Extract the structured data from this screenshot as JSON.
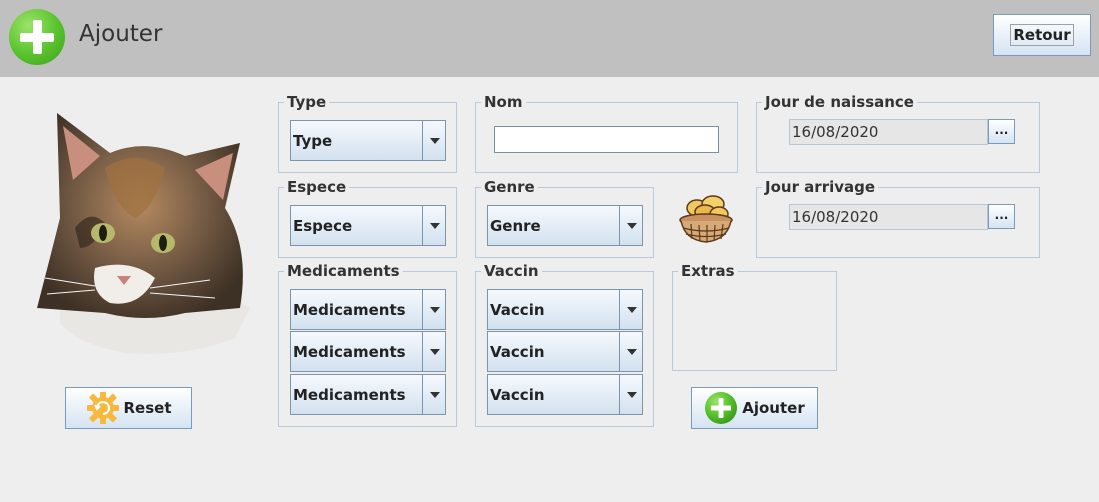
{
  "header": {
    "title": "Ajouter",
    "retour_label": "Retour"
  },
  "form": {
    "type": {
      "legend": "Type",
      "selected": "Type"
    },
    "nom": {
      "legend": "Nom",
      "value": ""
    },
    "jour_naissance": {
      "legend": "Jour de naissance",
      "value": "16/08/2020",
      "button_label": "..."
    },
    "espece": {
      "legend": "Espece",
      "selected": "Espece"
    },
    "genre": {
      "legend": "Genre",
      "selected": "Genre"
    },
    "jour_arrivage": {
      "legend": "Jour arrivage",
      "value": "16/08/2020",
      "button_label": "..."
    },
    "medicaments": {
      "legend": "Medicaments",
      "items": [
        "Medicaments",
        "Medicaments",
        "Medicaments"
      ]
    },
    "vaccin": {
      "legend": "Vaccin",
      "items": [
        "Vaccin",
        "Vaccin",
        "Vaccin"
      ]
    },
    "extras": {
      "legend": "Extras"
    }
  },
  "actions": {
    "reset_label": "Reset",
    "ajouter_label": "Ajouter"
  },
  "icons": {
    "header": "plus-circle-icon",
    "reset": "gear-refresh-icon",
    "ajouter": "plus-circle-icon",
    "picture": "cat-photo",
    "basket": "bread-basket-icon"
  },
  "colors": {
    "header_bg": "#c0c0c0",
    "page_bg": "#eeeeee",
    "accent_green": "#58c22c",
    "border_blue": "#b9c9db"
  }
}
